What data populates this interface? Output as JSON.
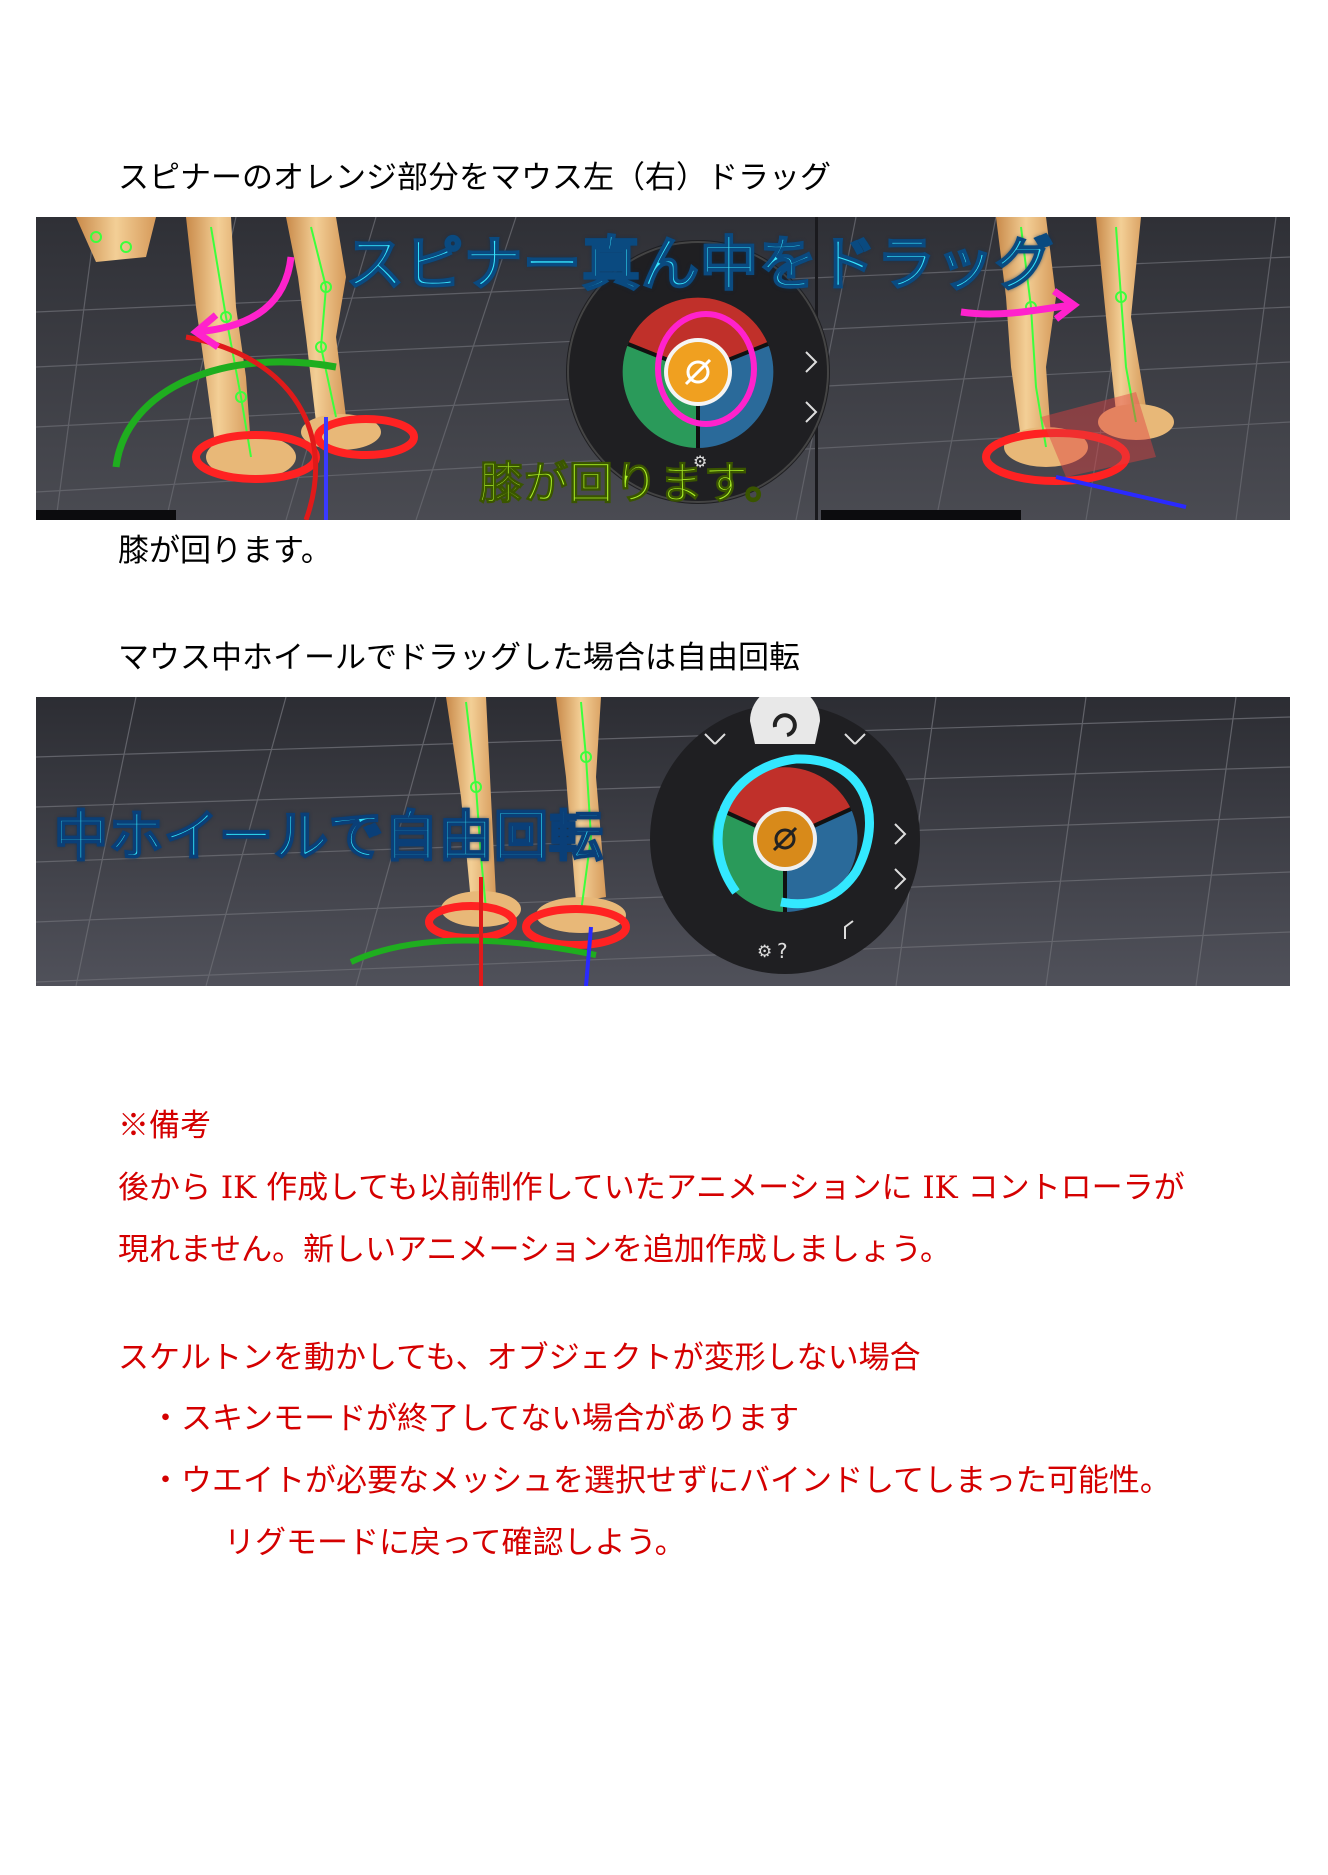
{
  "heading1": "スピナーのオレンジ部分をマウス左（右）ドラッグ",
  "shot1": {
    "caption_top": "スピナー真ん中をドラッグ",
    "caption_bottom": "膝が回ります。"
  },
  "line_knee": "膝が回ります。",
  "heading2": "マウス中ホイールでドラッグした場合は自由回転",
  "shot2": {
    "caption": "中ホイールで自由回転",
    "help_icon": "?",
    "settings_icon": "gear-icon"
  },
  "notes": {
    "title": "※備考",
    "line1": "後から IK 作成しても以前制作していたアニメーションに IK コントローラが",
    "line2": "現れません。新しいアニメーションを追加作成しましょう。",
    "line3": "スケルトンを動かしても、オブジェクトが変形しない場合",
    "line4": "・スキンモードが終了してない場合があります",
    "line5": "・ウエイトが必要なメッシュを選択せずにバインドしてしまった可能性。",
    "line6": "リグモードに戻って確認しよう。"
  },
  "colors": {
    "note_red": "#d40000",
    "caption_cyan": "#36e6ff",
    "caption_lime": "#a9ee26",
    "spinner_orange": "#f0a020",
    "spinner_red": "#c0302a",
    "spinner_green": "#2a9a5a",
    "spinner_blue": "#2a6a9a",
    "magenta_marker": "#ff22cc"
  }
}
